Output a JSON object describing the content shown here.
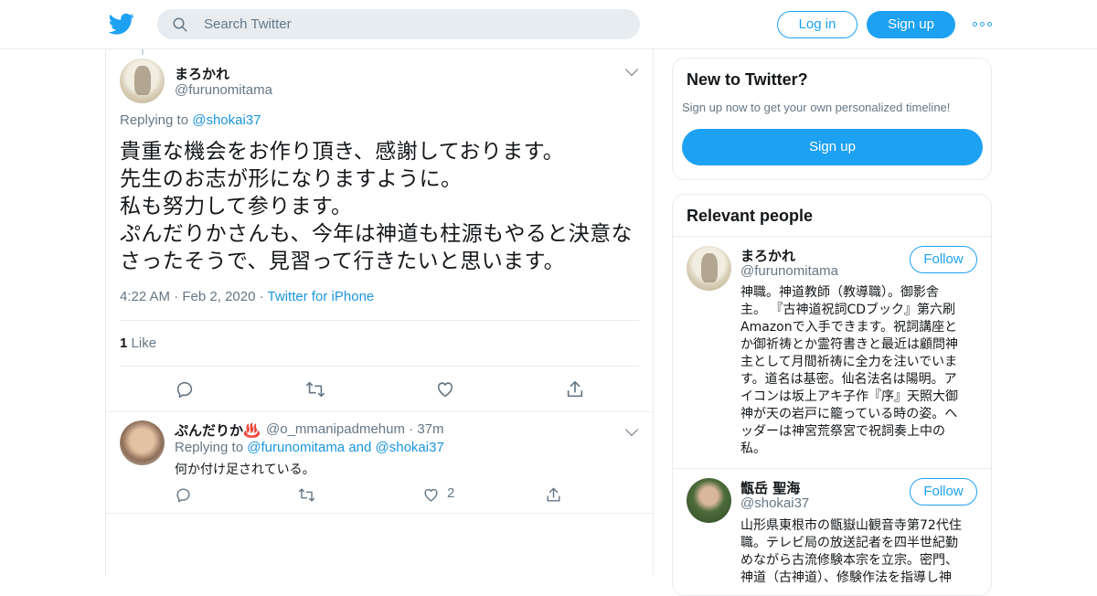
{
  "search": {
    "placeholder": "Search Twitter"
  },
  "header": {
    "login_label": "Log in",
    "signup_label": "Sign up"
  },
  "tweet": {
    "author_name": "まろかれ",
    "author_handle": "@furunomitama",
    "replying_prefix": "Replying to",
    "replying_to": "@shokai37",
    "text_lines": [
      "貴重な機会をお作り頂き、感謝しております。",
      "先生のお志が形になりますように。",
      "私も努力して参ります。",
      "ぷんだりかさんも、今年は神道も柱源もやると決意な",
      "さったそうで、見習って行きたいと思います。"
    ],
    "time": "4:22 AM",
    "date": "Feb 2, 2020",
    "source": "Twitter for iPhone",
    "like_count": "1",
    "like_label": "Like"
  },
  "reply": {
    "author_name": "ぷんだりか♨️",
    "author_handle": "@o_mmanipadmehum",
    "age": "37m",
    "replying_prefix": "Replying to",
    "replying_to": "@furunomitama and @shokai37",
    "text": "何か付け足されている。",
    "like_count": "2"
  },
  "new_to_twitter": {
    "title": "New to Twitter?",
    "subtitle": "Sign up now to get your own personalized timeline!",
    "signup_label": "Sign up"
  },
  "relevant_people": {
    "title": "Relevant people",
    "people": [
      {
        "name": "まろかれ",
        "handle": "@furunomitama",
        "follow_label": "Follow",
        "bio_lines": [
          "神職。神道教師（教導職）。御影舎",
          "主。 『古神道祝詞CDブック』第六刷",
          "Amazonで入手できます。祝詞講座と",
          "か御祈祷とか霊符書きと最近は顧問神",
          "主として月間祈祷に全力を注いでいま",
          "す。道名は基密。仙名法名は陽明。ア",
          "イコンは坂上アキ子作『序』天照大御",
          "神が天の岩戸に籠っている時の姿。ヘ",
          "ッダーは神宮荒祭宮で祝詞奏上中の",
          "私。"
        ]
      },
      {
        "name": "甑岳 聖海",
        "handle": "@shokai37",
        "follow_label": "Follow",
        "bio_lines": [
          "山形県東根市の甑嶽山観音寺第72代住",
          "職。テレビ局の放送記者を四半世紀勤",
          "めながら古流修験本宗を立宗。密門、",
          "神道（古神道）、修験作法を指導し神"
        ]
      }
    ]
  },
  "colors": {
    "accent": "#1da1f2",
    "link": "#1b95e0",
    "muted": "#657786",
    "border": "#e6ecf0"
  },
  "icons": [
    "twitter-bird-icon",
    "search-icon",
    "more-icon",
    "chevron-down-icon",
    "reply-icon",
    "retweet-icon",
    "like-icon",
    "share-icon"
  ]
}
